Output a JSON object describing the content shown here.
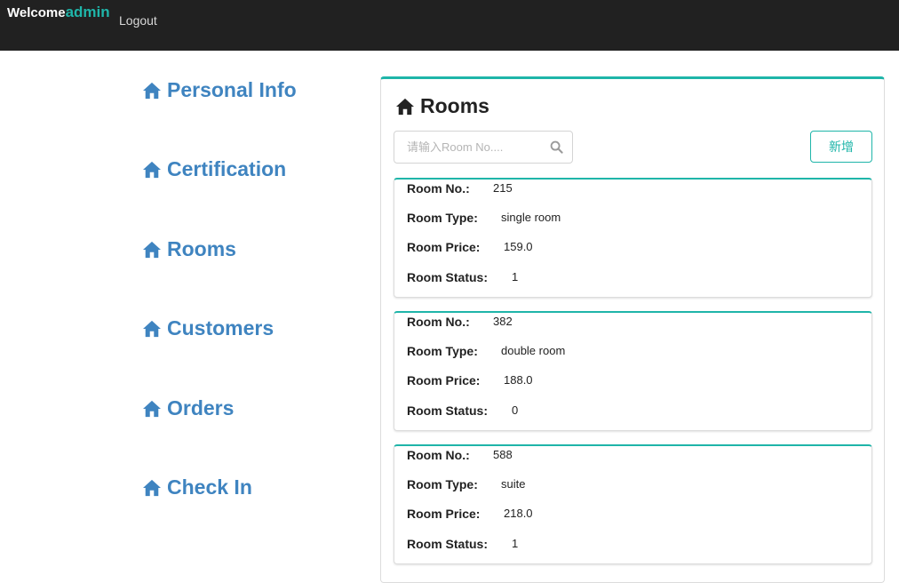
{
  "header": {
    "welcome_text": "Welcome",
    "username": "admin",
    "logout_label": "Logout"
  },
  "sidebar": {
    "items": [
      {
        "label": "Personal Info",
        "icon": "home-icon"
      },
      {
        "label": "Certification",
        "icon": "home-icon"
      },
      {
        "label": "Rooms",
        "icon": "home-icon"
      },
      {
        "label": "Customers",
        "icon": "home-icon"
      },
      {
        "label": "Orders",
        "icon": "home-icon"
      },
      {
        "label": "Check In",
        "icon": "home-icon"
      }
    ]
  },
  "main": {
    "title": "Rooms",
    "search": {
      "placeholder": "请输入Room No...."
    },
    "add_label": "新增",
    "field_labels": {
      "no": "Room No.:",
      "type": "Room Type:",
      "price": "Room Price:",
      "status": "Room Status:"
    },
    "rooms": [
      {
        "no": "215",
        "type": "single room",
        "price": "159.0",
        "status": "1"
      },
      {
        "no": "382",
        "type": "double room",
        "price": "188.0",
        "status": "0"
      },
      {
        "no": "588",
        "type": "suite",
        "price": "218.0",
        "status": "1"
      }
    ]
  },
  "colors": {
    "accent": "#1fb5a9",
    "nav_link": "#3f84c0",
    "topbar": "#212121"
  }
}
